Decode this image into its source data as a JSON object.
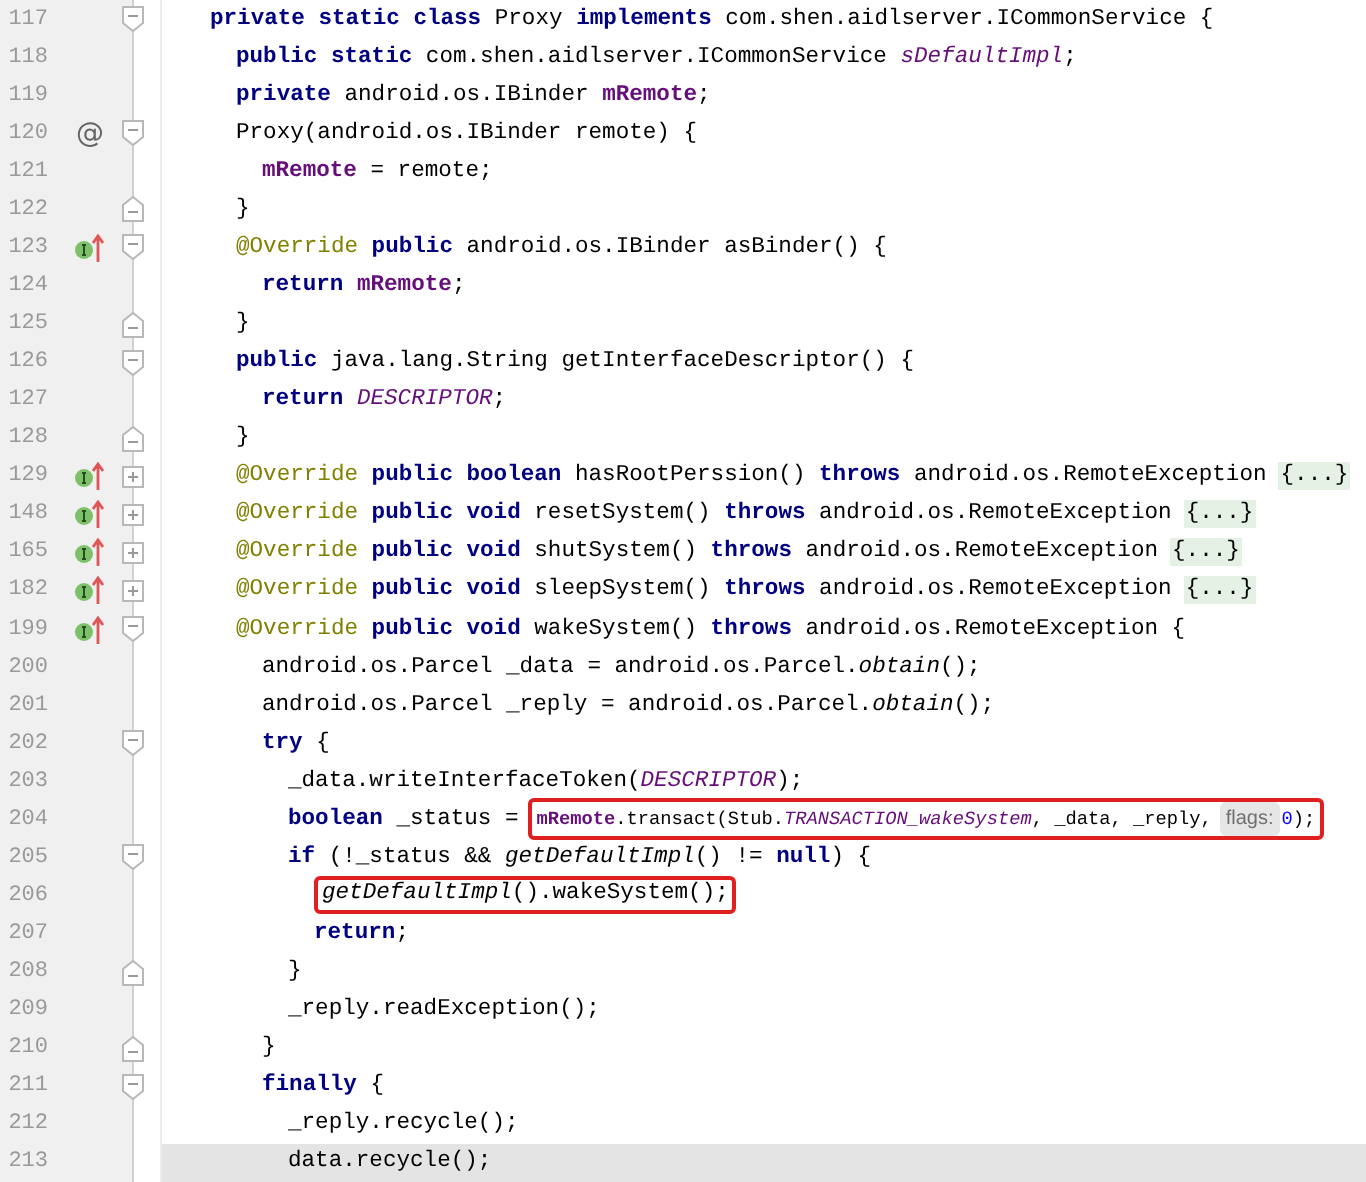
{
  "editor": {
    "lines": [
      {
        "number": "117",
        "fold_marker": {
          "kind": "start"
        },
        "parts": [
          {
            "kind": "code",
            "tokens": [
              {
                "kind": "kw",
                "text": "private static class"
              },
              {
                "kind": "plain",
                "text": " Proxy "
              },
              {
                "kind": "kw",
                "text": "implements"
              },
              {
                "kind": "plain",
                "text": " com.shen.aidlserver.ICommonService {"
              }
            ]
          }
        ]
      },
      {
        "number": "118",
        "parts": [
          {
            "kind": "code",
            "tokens": [
              {
                "kind": "kw",
                "text": "public static"
              },
              {
                "kind": "plain",
                "text": " com.shen.aidlserver.ICommonService "
              },
              {
                "kind": "static",
                "text": "sDefaultImpl"
              },
              {
                "kind": "plain",
                "text": ";"
              }
            ]
          }
        ]
      },
      {
        "number": "119",
        "parts": [
          {
            "kind": "code",
            "tokens": [
              {
                "kind": "kw",
                "text": "private"
              },
              {
                "kind": "plain",
                "text": " android.os.IBinder "
              },
              {
                "kind": "field",
                "text": "mRemote"
              },
              {
                "kind": "plain",
                "text": ";"
              }
            ]
          }
        ]
      },
      {
        "number": "120",
        "marker": {
          "kind": "text",
          "text": "@"
        },
        "fold_marker": {
          "kind": "start"
        },
        "parts": [
          {
            "kind": "code",
            "tokens": [
              {
                "kind": "plain",
                "text": "Proxy(android.os.IBinder remote) {"
              }
            ]
          }
        ]
      },
      {
        "number": "121",
        "parts": [
          {
            "kind": "code",
            "tokens": [
              {
                "kind": "field",
                "text": "mRemote"
              },
              {
                "kind": "plain",
                "text": " = remote;"
              }
            ]
          }
        ]
      },
      {
        "number": "122",
        "fold_marker": {
          "kind": "end"
        },
        "parts": [
          {
            "kind": "code",
            "tokens": [
              {
                "kind": "plain",
                "text": "}"
              }
            ]
          }
        ]
      },
      {
        "number": "123",
        "marker": {
          "kind": "implements"
        },
        "fold_marker": {
          "kind": "start"
        },
        "parts": [
          {
            "kind": "code",
            "tokens": [
              {
                "kind": "ann",
                "text": "@Override "
              },
              {
                "kind": "kw",
                "text": "public"
              },
              {
                "kind": "plain",
                "text": " android.os.IBinder asBinder() {"
              }
            ]
          }
        ]
      },
      {
        "number": "124",
        "parts": [
          {
            "kind": "code",
            "tokens": [
              {
                "kind": "kw",
                "text": "return "
              },
              {
                "kind": "field",
                "text": "mRemote"
              },
              {
                "kind": "plain",
                "text": ";"
              }
            ]
          }
        ]
      },
      {
        "number": "125",
        "fold_marker": {
          "kind": "end"
        },
        "parts": [
          {
            "kind": "code",
            "tokens": [
              {
                "kind": "plain",
                "text": "}"
              }
            ]
          }
        ]
      },
      {
        "number": "126",
        "fold_marker": {
          "kind": "start"
        },
        "parts": [
          {
            "kind": "code",
            "tokens": [
              {
                "kind": "kw",
                "text": "public"
              },
              {
                "kind": "plain",
                "text": " java.lang.String getInterfaceDescriptor() {"
              }
            ]
          }
        ]
      },
      {
        "number": "127",
        "parts": [
          {
            "kind": "code",
            "tokens": [
              {
                "kind": "kw",
                "text": "return "
              },
              {
                "kind": "static",
                "text": "DESCRIPTOR"
              },
              {
                "kind": "plain",
                "text": ";"
              }
            ]
          }
        ]
      },
      {
        "number": "128",
        "fold_marker": {
          "kind": "end"
        },
        "parts": [
          {
            "kind": "code",
            "tokens": [
              {
                "kind": "plain",
                "text": "}"
              }
            ]
          }
        ]
      },
      {
        "number": "129",
        "marker": {
          "kind": "implements"
        },
        "fold_marker": {
          "kind": "collapsed"
        },
        "parts": [
          {
            "kind": "code",
            "tokens": [
              {
                "kind": "ann",
                "text": "@Override "
              },
              {
                "kind": "kw",
                "text": "public boolean"
              },
              {
                "kind": "plain",
                "text": " hasRootPerssion() "
              },
              {
                "kind": "kw",
                "text": "throws"
              },
              {
                "kind": "plain",
                "text": " android.os.RemoteException"
              }
            ]
          },
          {
            "kind": "folded",
            "text": "{...}"
          }
        ]
      },
      {
        "number": "148",
        "marker": {
          "kind": "implements"
        },
        "fold_marker": {
          "kind": "collapsed"
        },
        "parts": [
          {
            "kind": "code",
            "tokens": [
              {
                "kind": "ann",
                "text": "@Override "
              },
              {
                "kind": "kw",
                "text": "public void"
              },
              {
                "kind": "plain",
                "text": " resetSystem() "
              },
              {
                "kind": "kw",
                "text": "throws"
              },
              {
                "kind": "plain",
                "text": " android.os.RemoteException"
              }
            ]
          },
          {
            "kind": "folded",
            "text": "{...}"
          }
        ]
      },
      {
        "number": "165",
        "marker": {
          "kind": "implements"
        },
        "fold_marker": {
          "kind": "collapsed"
        },
        "parts": [
          {
            "kind": "code",
            "tokens": [
              {
                "kind": "ann",
                "text": "@Override "
              },
              {
                "kind": "kw",
                "text": "public void"
              },
              {
                "kind": "plain",
                "text": " shutSystem() "
              },
              {
                "kind": "kw",
                "text": "throws"
              },
              {
                "kind": "plain",
                "text": " android.os.RemoteException"
              }
            ]
          },
          {
            "kind": "folded",
            "text": "{...}"
          }
        ]
      },
      {
        "number": "182",
        "marker": {
          "kind": "implements"
        },
        "fold_marker": {
          "kind": "collapsed"
        },
        "parts": [
          {
            "kind": "code",
            "tokens": [
              {
                "kind": "ann",
                "text": "@Override "
              },
              {
                "kind": "kw",
                "text": "public void"
              },
              {
                "kind": "plain",
                "text": " sleepSystem() "
              },
              {
                "kind": "kw",
                "text": "throws"
              },
              {
                "kind": "plain",
                "text": " android.os.RemoteException"
              }
            ]
          },
          {
            "kind": "folded",
            "text": "{...}"
          }
        ]
      },
      {
        "number": "199",
        "marker": {
          "kind": "implements"
        },
        "fold_marker": {
          "kind": "start"
        },
        "parts": [
          {
            "kind": "code",
            "tokens": [
              {
                "kind": "ann",
                "text": "@Override "
              },
              {
                "kind": "kw",
                "text": "public void"
              },
              {
                "kind": "plain",
                "text": " wakeSystem() "
              },
              {
                "kind": "kw",
                "text": "throws"
              },
              {
                "kind": "plain",
                "text": " android.os.RemoteException {"
              }
            ]
          }
        ]
      },
      {
        "number": "200",
        "parts": [
          {
            "kind": "code",
            "tokens": [
              {
                "kind": "plain",
                "text": "android.os.Parcel _data = android.os.Parcel."
              },
              {
                "kind": "call",
                "text": "obtain"
              },
              {
                "kind": "plain",
                "text": "();"
              }
            ]
          }
        ]
      },
      {
        "number": "201",
        "parts": [
          {
            "kind": "code",
            "tokens": [
              {
                "kind": "plain",
                "text": "android.os.Parcel _reply = android.os.Parcel."
              },
              {
                "kind": "call",
                "text": "obtain"
              },
              {
                "kind": "plain",
                "text": "();"
              }
            ]
          }
        ]
      },
      {
        "number": "202",
        "fold_marker": {
          "kind": "start"
        },
        "parts": [
          {
            "kind": "code",
            "tokens": [
              {
                "kind": "kw",
                "text": "try"
              },
              {
                "kind": "plain",
                "text": " {"
              }
            ]
          }
        ]
      },
      {
        "number": "203",
        "parts": [
          {
            "kind": "code",
            "tokens": [
              {
                "kind": "plain",
                "text": "_data.writeInterfaceToken("
              },
              {
                "kind": "static",
                "text": "DESCRIPTOR"
              },
              {
                "kind": "plain",
                "text": ");"
              }
            ]
          }
        ]
      },
      {
        "number": "204",
        "parts": [
          {
            "kind": "code",
            "tokens": [
              {
                "kind": "kw",
                "text": "boolean"
              },
              {
                "kind": "plain",
                "text": " _status ="
              }
            ]
          },
          {
            "kind": "boxed",
            "parts": [
              {
                "kind": "code",
                "tokens": [
                  {
                    "kind": "field",
                    "text": "mRemote"
                  },
                  {
                    "kind": "plain",
                    "text": ".transact(Stub."
                  },
                  {
                    "kind": "static",
                    "text": "TRANSACTION_wakeSystem"
                  },
                  {
                    "kind": "plain",
                    "text": ", _data, _reply,"
                  }
                ]
              },
              {
                "kind": "hint",
                "text": "flags:"
              },
              {
                "kind": "code",
                "tokens": [
                  {
                    "kind": "num",
                    "text": "0"
                  },
                  {
                    "kind": "plain",
                    "text": ");"
                  }
                ]
              }
            ]
          }
        ]
      },
      {
        "number": "205",
        "fold_marker": {
          "kind": "start"
        },
        "parts": [
          {
            "kind": "code",
            "tokens": [
              {
                "kind": "kw",
                "text": "if"
              },
              {
                "kind": "plain",
                "text": " (!_status && "
              },
              {
                "kind": "call",
                "text": "getDefaultImpl"
              },
              {
                "kind": "plain",
                "text": "() != "
              },
              {
                "kind": "kw",
                "text": "null"
              },
              {
                "kind": "plain",
                "text": ") {"
              }
            ]
          }
        ]
      },
      {
        "number": "206",
        "parts": [
          {
            "kind": "boxed",
            "parts": [
              {
                "kind": "code",
                "tokens": [
                  {
                    "kind": "call",
                    "text": "getDefaultImpl"
                  },
                  {
                    "kind": "plain",
                    "text": "().wakeSystem();"
                  }
                ]
              }
            ]
          }
        ]
      },
      {
        "number": "207",
        "parts": [
          {
            "kind": "code",
            "tokens": [
              {
                "kind": "kw",
                "text": "return"
              },
              {
                "kind": "plain",
                "text": ";"
              }
            ]
          }
        ]
      },
      {
        "number": "208",
        "fold_marker": {
          "kind": "end"
        },
        "parts": [
          {
            "kind": "code",
            "tokens": [
              {
                "kind": "plain",
                "text": "}"
              }
            ]
          }
        ]
      },
      {
        "number": "209",
        "parts": [
          {
            "kind": "code",
            "tokens": [
              {
                "kind": "plain",
                "text": "_reply.readException();"
              }
            ]
          }
        ]
      },
      {
        "number": "210",
        "fold_marker": {
          "kind": "end"
        },
        "parts": [
          {
            "kind": "code",
            "tokens": [
              {
                "kind": "plain",
                "text": "}"
              }
            ]
          }
        ]
      },
      {
        "number": "211",
        "fold_marker": {
          "kind": "start"
        },
        "parts": [
          {
            "kind": "code",
            "tokens": [
              {
                "kind": "kw",
                "text": "finally"
              },
              {
                "kind": "plain",
                "text": " {"
              }
            ]
          }
        ]
      },
      {
        "number": "212",
        "parts": [
          {
            "kind": "code",
            "tokens": [
              {
                "kind": "plain",
                "text": "_reply.recycle();"
              }
            ]
          }
        ]
      },
      {
        "number": "213",
        "current": true,
        "parts": [
          {
            "kind": "code",
            "tokens": [
              {
                "kind": "plain",
                "text": "data.recycle();"
              }
            ]
          }
        ]
      }
    ]
  }
}
